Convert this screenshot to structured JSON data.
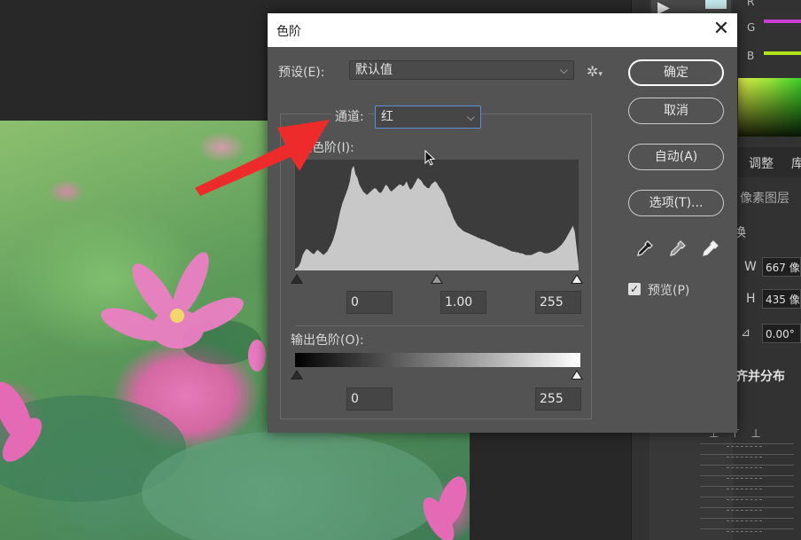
{
  "dialog": {
    "title": "色阶",
    "close_glyph": "✕",
    "preset_label": "预设(E):",
    "preset_value": "默认值",
    "channel_label": "通道:",
    "channel_value": "红",
    "input_levels_label": "入色阶(I):",
    "output_levels_label": "输出色阶(O):",
    "input_values": {
      "black": "0",
      "gamma": "1.00",
      "white": "255"
    },
    "output_values": {
      "black": "0",
      "white": "255"
    },
    "buttons": {
      "ok": "确定",
      "cancel": "取消",
      "auto": "自动(A)",
      "options": "选项(T)..."
    },
    "preview_label": "预览(P)",
    "preview_checked": true
  },
  "right_panel": {
    "rgb_labels": {
      "r": "R",
      "g": "G",
      "b": "B"
    },
    "rgb_colors": {
      "r": "#c93dd8",
      "g": "#c93dd8",
      "b": "#b5e31c"
    },
    "tab_adjust": "调整",
    "tab_lib": "库",
    "pixel_layer": "像素图层",
    "transform": "换",
    "w_label": "W",
    "w_value": "667 像",
    "h_label": "H",
    "h_value": "435 像",
    "angle_value": "0.00°",
    "align_title": "齐并分布"
  },
  "histogram": {
    "channel": "red",
    "levels": [
      2,
      3,
      5,
      10,
      18,
      22,
      25,
      24,
      22,
      20,
      19,
      22,
      24,
      22,
      20,
      18,
      20,
      22,
      26,
      30,
      35,
      42,
      50,
      60,
      70,
      78,
      84,
      90,
      96,
      104,
      118,
      122,
      112,
      108,
      100,
      96,
      92,
      90,
      88,
      90,
      92,
      94,
      96,
      95,
      92,
      90,
      92,
      96,
      100,
      98,
      94,
      92,
      94,
      96,
      98,
      100,
      100,
      98,
      100,
      104,
      98,
      94,
      96,
      100,
      104,
      108,
      106,
      104,
      100,
      98,
      96,
      96,
      100,
      102,
      104,
      102,
      98,
      95,
      92,
      88,
      82,
      76,
      72,
      66,
      60,
      56,
      52,
      50,
      48,
      46,
      45,
      44,
      43,
      42,
      41,
      40,
      39,
      38,
      37,
      36,
      36,
      35,
      34,
      33,
      32,
      31,
      30,
      29,
      28,
      28,
      27,
      26,
      25,
      24,
      23,
      22,
      22,
      21,
      21,
      20,
      20,
      19,
      18,
      18,
      18,
      18,
      19,
      20,
      21,
      22,
      22,
      21,
      20,
      20,
      20,
      21,
      22,
      23,
      24,
      26,
      28,
      30,
      33,
      36,
      40,
      44,
      48,
      52,
      45,
      25,
      6
    ]
  }
}
